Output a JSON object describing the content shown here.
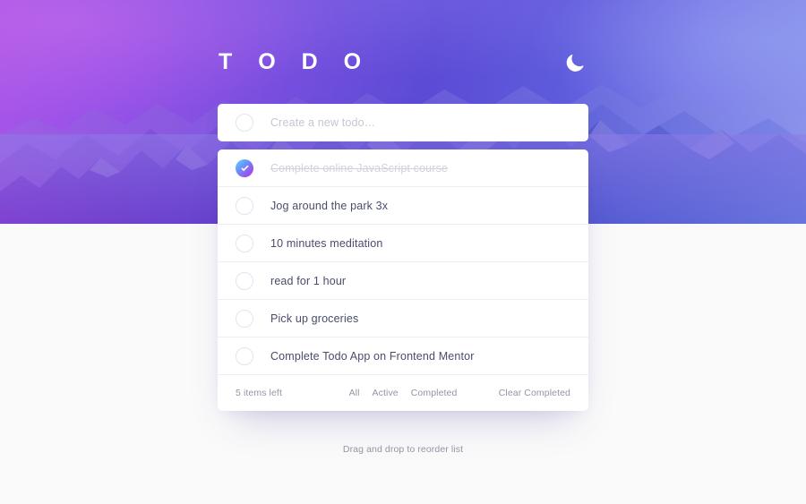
{
  "header": {
    "title": "T O D O",
    "theme_toggle_icon": "moon-icon",
    "theme_toggle_label": "Toggle dark mode"
  },
  "new_todo": {
    "value": "",
    "placeholder": "Create a new todo…"
  },
  "todos": [
    {
      "text": "Complete online JavaScript course",
      "completed": true
    },
    {
      "text": "Jog around the park 3x",
      "completed": false
    },
    {
      "text": "10 minutes meditation",
      "completed": false
    },
    {
      "text": "read for 1 hour",
      "completed": false
    },
    {
      "text": "Pick up groceries",
      "completed": false
    },
    {
      "text": "Complete Todo App on Frontend Mentor",
      "completed": false
    }
  ],
  "footer": {
    "items_left": "5 items left",
    "filters": [
      {
        "label": "All",
        "active": false
      },
      {
        "label": "Active",
        "active": false
      },
      {
        "label": "Completed",
        "active": false
      }
    ],
    "clear_completed": "Clear Completed"
  },
  "hint": "Drag and drop to reorder list",
  "colors": {
    "text_primary": "#494C6B",
    "text_muted": "#9495A5",
    "text_completed": "#D1D2DA",
    "card_bg": "#FFFFFF",
    "page_bg": "#FAFAFA",
    "divider": "#EDEEF3",
    "check_gradient_start": "#55DDFF",
    "check_gradient_end": "#C058F3",
    "hero_left": "#A855E8",
    "hero_right": "#8B93EC"
  }
}
